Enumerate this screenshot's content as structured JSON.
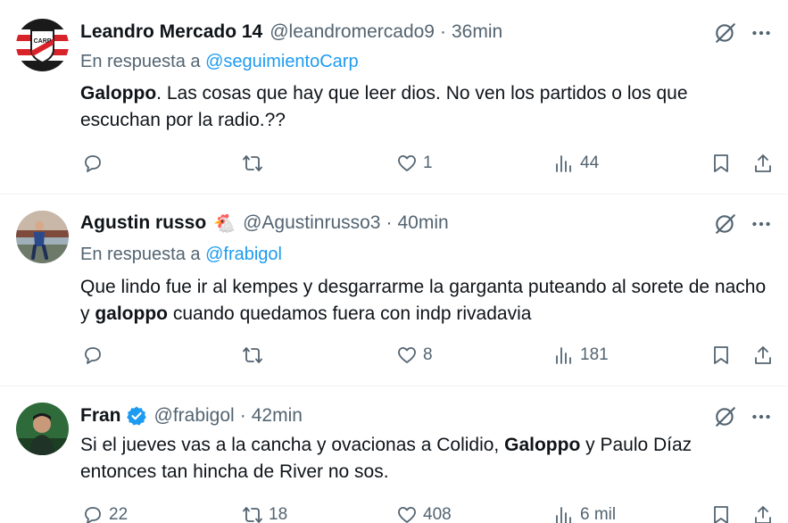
{
  "tweets": [
    {
      "name": "Leandro Mercado 14",
      "handle": "@leandromercado9",
      "separator": "·",
      "time": "36min",
      "reply_prefix": "En respuesta a",
      "reply_handle": "@seguimientoCarp",
      "text_bold_1": "Galoppo",
      "text_rest_1": ". Las cosas que hay que leer dios. No ven los partidos o los que escuchan por la radio.??",
      "replies": "",
      "retweets": "",
      "likes": "1",
      "views": "44"
    },
    {
      "name": "Agustin russo",
      "emoji": "🐔",
      "handle": "@Agustinrusso3",
      "separator": "·",
      "time": "40min",
      "reply_prefix": "En respuesta a",
      "reply_handle": "@frabigol",
      "text_part_1": "Que lindo fue ir al kempes y desgarrarme la garganta puteando al sorete de nacho y ",
      "text_bold_1": "galoppo",
      "text_part_2": " cuando quedamos fuera con indp rivadavia",
      "replies": "",
      "retweets": "",
      "likes": "8",
      "views": "181"
    },
    {
      "name": "Fran",
      "handle": "@frabigol",
      "separator": "·",
      "time": "42min",
      "text_part_1": "Si el jueves vas a la cancha y ovacionas a Colidio, ",
      "text_bold_1": "Galoppo",
      "text_part_2": " y Paulo Díaz entonces tan hincha de River no sos.",
      "replies": "22",
      "retweets": "18",
      "likes": "408",
      "views": "6 mil"
    }
  ],
  "icons": {
    "reply": "reply-icon",
    "retweet": "retweet-icon",
    "like": "like-icon",
    "views": "views-icon",
    "bookmark": "bookmark-icon",
    "share": "share-icon",
    "grok": "grok-icon",
    "more": "more-icon",
    "verified": "verified-badge-icon"
  },
  "colors": {
    "text": "#0f1419",
    "secondary": "#536471",
    "link": "#1d9bf0",
    "border": "#eff3f4"
  }
}
